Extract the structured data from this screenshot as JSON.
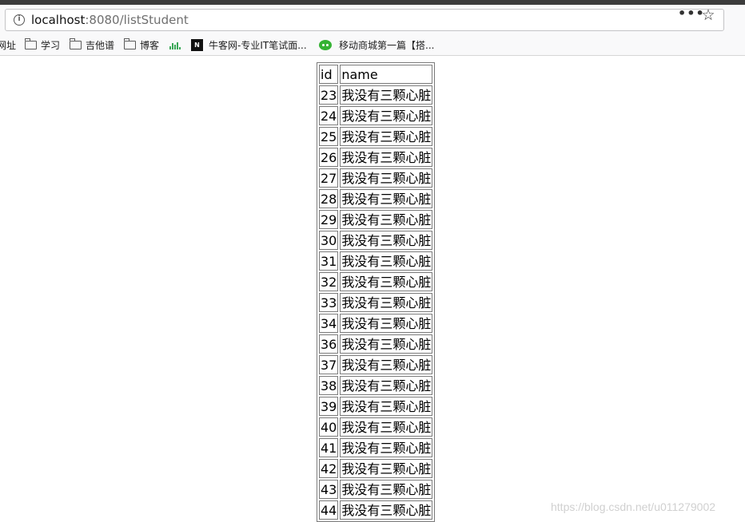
{
  "browser": {
    "url_host": "localhost",
    "url_rest": ":8080/listStudent",
    "more_label": "•••",
    "star_label": "☆"
  },
  "bookmarks": [
    {
      "label": "网址",
      "icon": "none"
    },
    {
      "label": "学习",
      "icon": "folder-icon"
    },
    {
      "label": "吉他谱",
      "icon": "folder-icon"
    },
    {
      "label": "博客",
      "icon": "folder-icon"
    },
    {
      "label": "",
      "icon": "audio-icon"
    },
    {
      "label": "牛客网-专业IT笔试面...",
      "icon": "nowcoder-icon"
    },
    {
      "label": "移动商城第一篇【搭...",
      "icon": "chat-icon"
    }
  ],
  "table": {
    "headers": [
      "id",
      "name"
    ],
    "rows": [
      [
        "23",
        "我没有三颗心脏"
      ],
      [
        "24",
        "我没有三颗心脏"
      ],
      [
        "25",
        "我没有三颗心脏"
      ],
      [
        "26",
        "我没有三颗心脏"
      ],
      [
        "27",
        "我没有三颗心脏"
      ],
      [
        "28",
        "我没有三颗心脏"
      ],
      [
        "29",
        "我没有三颗心脏"
      ],
      [
        "30",
        "我没有三颗心脏"
      ],
      [
        "31",
        "我没有三颗心脏"
      ],
      [
        "32",
        "我没有三颗心脏"
      ],
      [
        "33",
        "我没有三颗心脏"
      ],
      [
        "34",
        "我没有三颗心脏"
      ],
      [
        "36",
        "我没有三颗心脏"
      ],
      [
        "37",
        "我没有三颗心脏"
      ],
      [
        "38",
        "我没有三颗心脏"
      ],
      [
        "39",
        "我没有三颗心脏"
      ],
      [
        "40",
        "我没有三颗心脏"
      ],
      [
        "41",
        "我没有三颗心脏"
      ],
      [
        "42",
        "我没有三颗心脏"
      ],
      [
        "43",
        "我没有三颗心脏"
      ],
      [
        "44",
        "我没有三颗心脏"
      ]
    ]
  },
  "watermark": "https://blog.csdn.net/u011279002",
  "colors": {
    "chat_icon": "#34b233",
    "audio_icon": "#3aa757"
  }
}
